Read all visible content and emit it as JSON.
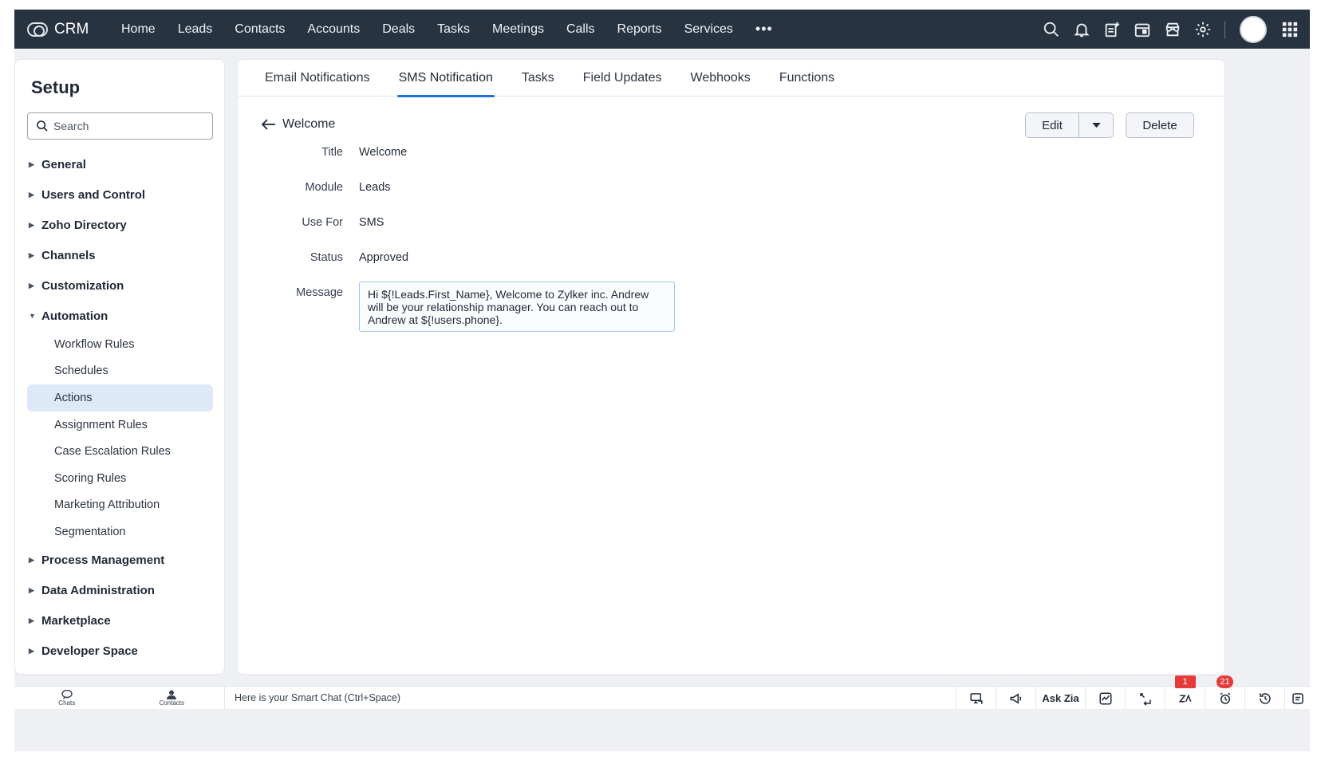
{
  "topnav": {
    "brand": "CRM",
    "items": [
      "Home",
      "Leads",
      "Contacts",
      "Accounts",
      "Deals",
      "Tasks",
      "Meetings",
      "Calls",
      "Reports",
      "Services"
    ],
    "more": "•••"
  },
  "sidebar": {
    "title": "Setup",
    "search_placeholder": "Search",
    "groups": [
      "General",
      "Users and Control",
      "Zoho Directory",
      "Channels",
      "Customization"
    ],
    "automation": {
      "label": "Automation",
      "items": [
        "Workflow Rules",
        "Schedules",
        "Actions",
        "Assignment Rules",
        "Case Escalation Rules",
        "Scoring Rules",
        "Marketing Attribution",
        "Segmentation"
      ],
      "active": "Actions"
    },
    "groups_after": [
      "Process Management",
      "Data Administration",
      "Marketplace",
      "Developer Space"
    ]
  },
  "tabs": [
    "Email Notifications",
    "SMS Notification",
    "Tasks",
    "Field Updates",
    "Webhooks",
    "Functions"
  ],
  "active_tab": "SMS Notification",
  "detail": {
    "name": "Welcome",
    "edit_label": "Edit",
    "delete_label": "Delete",
    "fields": [
      {
        "label": "Title",
        "value": "Welcome"
      },
      {
        "label": "Module",
        "value": "Leads"
      },
      {
        "label": "Use For",
        "value": "SMS"
      },
      {
        "label": "Status",
        "value": "Approved"
      }
    ],
    "message_label": "Message",
    "message": "Hi ${!Leads.First_Name}, Welcome to Zylker inc. Andrew will be your relationship manager. You can reach out to Andrew at ${!users.phone}."
  },
  "bottombar": {
    "chats": "Chats",
    "contacts": "Contacts",
    "smart_chat": "Here is your Smart Chat (Ctrl+Space)",
    "ask_zia": "Ask Zia",
    "badge_zia": "1",
    "badge_alarm": "21"
  },
  "colors": {
    "nav_bg": "#283341",
    "accent": "#1a73d9",
    "active_item_bg": "#dde9f7",
    "badge": "#e43b3b"
  }
}
